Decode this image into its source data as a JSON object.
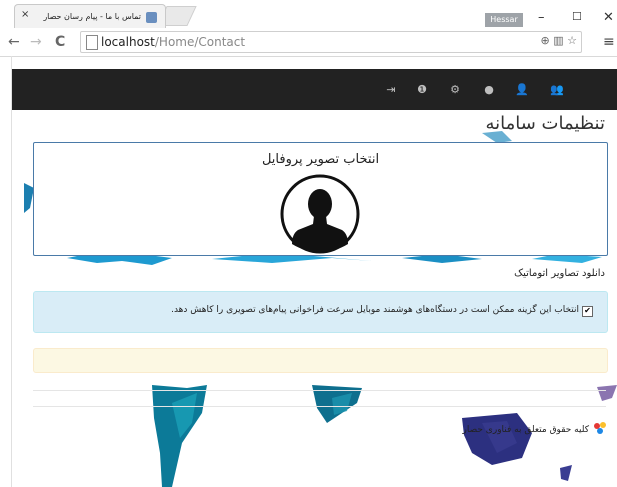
{
  "browser": {
    "tab_title": "تماس با ما - پیام رسان حصار",
    "tab_close": "×",
    "user_badge": "Hessar",
    "window_controls": {
      "minimize": "–",
      "maximize": "☐",
      "close": "✕"
    },
    "nav": {
      "back": "←",
      "forward": "→",
      "reload": "C"
    },
    "url_host": "localhost",
    "url_path": "/Home/Contact",
    "omni_icons": "⊕ ▥ ☆",
    "menu": "≡"
  },
  "navbar": {
    "icons": [
      "logout-icon",
      "info-icon",
      "settings-icon",
      "chat-icon",
      "add-user-icon",
      "users-icon"
    ],
    "glyphs": [
      "⇥",
      "❶",
      "⚙",
      "●",
      "👤",
      "👥"
    ]
  },
  "page": {
    "title": "تنظیمات سامانه",
    "profile_title": "انتخاب تصویر پروفایل",
    "auto_download_label": "دانلود تصاویر اتوماتیک",
    "checkbox_checked": "✔",
    "info_text": "انتخاب این گزینه ممکن است در دستگاه‌های هوشمند موبایل سرعت فراخوانی پیام‌های تصویری را کاهش دهد.",
    "footer_text": "کلیه حقوق متعلق به فناوری حصار"
  },
  "colors": {
    "navbar_bg": "#222222",
    "info_bg": "#d9edf7",
    "warning_bg": "#fcf8e3",
    "profile_border": "#4a7aa8"
  }
}
